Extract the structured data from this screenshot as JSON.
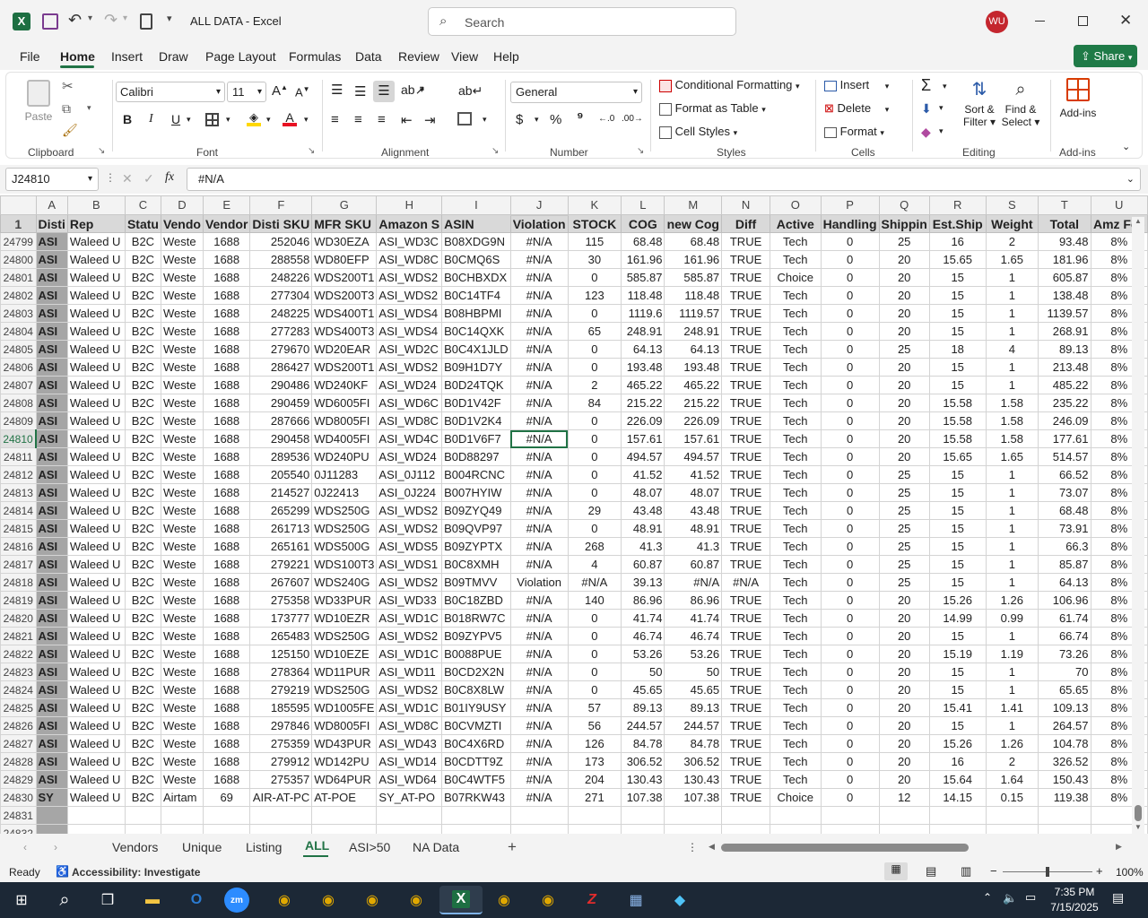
{
  "title": {
    "doc_name": "ALL DATA",
    "app_name": "Excel",
    "separator": "-",
    "search_placeholder": "Search",
    "user_initials": "WU"
  },
  "menu": {
    "tabs": [
      "File",
      "Home",
      "Insert",
      "Draw",
      "Page Layout",
      "Formulas",
      "Data",
      "Review",
      "View",
      "Help"
    ],
    "active": "Home",
    "share": "Share"
  },
  "ribbon": {
    "clipboard": {
      "label": "Clipboard",
      "paste": "Paste"
    },
    "font": {
      "label": "Font",
      "name": "Calibri",
      "size": "11"
    },
    "alignment": {
      "label": "Alignment"
    },
    "number": {
      "label": "Number",
      "format": "General"
    },
    "styles": {
      "label": "Styles",
      "conditional": "Conditional Formatting",
      "format_table": "Format as Table",
      "cell_styles": "Cell Styles"
    },
    "cells": {
      "label": "Cells",
      "insert": "Insert",
      "delete": "Delete",
      "format": "Format"
    },
    "editing": {
      "label": "Editing",
      "sort1": "Sort &",
      "sort2": "Filter",
      "find1": "Find &",
      "find2": "Select"
    },
    "addins": {
      "label": "Add-ins",
      "addins_btn": "Add-ins"
    }
  },
  "formula_bar": {
    "name_box": "J24810",
    "fx": "fx",
    "value": "#N/A"
  },
  "columns": [
    "A",
    "B",
    "C",
    "D",
    "E",
    "F",
    "G",
    "H",
    "I",
    "J",
    "K",
    "L",
    "M",
    "N",
    "O",
    "P",
    "Q",
    "R",
    "S",
    "T",
    "U"
  ],
  "header_row": {
    "num": "1",
    "cells": [
      "Disti",
      "Rep",
      "Statu",
      "Vendo",
      "Vendor",
      "Disti SKU",
      "MFR SKU",
      "Amazon S",
      "ASIN",
      "Violation",
      "STOCK",
      "COG",
      "new Cog",
      "Diff",
      "Active",
      "Handling",
      "Shippin",
      "Est.Ship",
      "Weight",
      "Total",
      "Amz Fee"
    ]
  },
  "rows": [
    {
      "num": "24799",
      "cells": [
        "ASI",
        "Waleed U",
        "B2C",
        "Weste",
        "1688",
        "252046",
        "WD30EZA",
        "ASI_WD3C",
        "B08XDG9N",
        "#N/A",
        "115",
        "68.48",
        "68.48",
        "TRUE",
        "Tech",
        "0",
        "25",
        "16",
        "2",
        "93.48",
        "8%"
      ]
    },
    {
      "num": "24800",
      "cells": [
        "ASI",
        "Waleed U",
        "B2C",
        "Weste",
        "1688",
        "288558",
        "WD80EFP",
        "ASI_WD8C",
        "B0CMQ6S",
        "#N/A",
        "30",
        "161.96",
        "161.96",
        "TRUE",
        "Tech",
        "0",
        "20",
        "15.65",
        "1.65",
        "181.96",
        "8%"
      ]
    },
    {
      "num": "24801",
      "cells": [
        "ASI",
        "Waleed U",
        "B2C",
        "Weste",
        "1688",
        "248226",
        "WDS200T1",
        "ASI_WDS2",
        "B0CHBXDX",
        "#N/A",
        "0",
        "585.87",
        "585.87",
        "TRUE",
        "Choice",
        "0",
        "20",
        "15",
        "1",
        "605.87",
        "8%"
      ]
    },
    {
      "num": "24802",
      "cells": [
        "ASI",
        "Waleed U",
        "B2C",
        "Weste",
        "1688",
        "277304",
        "WDS200T3",
        "ASI_WDS2",
        "B0C14TF4",
        "#N/A",
        "123",
        "118.48",
        "118.48",
        "TRUE",
        "Tech",
        "0",
        "20",
        "15",
        "1",
        "138.48",
        "8%"
      ]
    },
    {
      "num": "24803",
      "cells": [
        "ASI",
        "Waleed U",
        "B2C",
        "Weste",
        "1688",
        "248225",
        "WDS400T1",
        "ASI_WDS4",
        "B08HBPMI",
        "#N/A",
        "0",
        "1119.6",
        "1119.57",
        "TRUE",
        "Tech",
        "0",
        "20",
        "15",
        "1",
        "1139.57",
        "8%"
      ]
    },
    {
      "num": "24804",
      "cells": [
        "ASI",
        "Waleed U",
        "B2C",
        "Weste",
        "1688",
        "277283",
        "WDS400T3",
        "ASI_WDS4",
        "B0C14QXK",
        "#N/A",
        "65",
        "248.91",
        "248.91",
        "TRUE",
        "Tech",
        "0",
        "20",
        "15",
        "1",
        "268.91",
        "8%"
      ]
    },
    {
      "num": "24805",
      "cells": [
        "ASI",
        "Waleed U",
        "B2C",
        "Weste",
        "1688",
        "279670",
        "WD20EAR",
        "ASI_WD2C",
        "B0C4X1JLD",
        "#N/A",
        "0",
        "64.13",
        "64.13",
        "TRUE",
        "Tech",
        "0",
        "25",
        "18",
        "4",
        "89.13",
        "8%"
      ]
    },
    {
      "num": "24806",
      "cells": [
        "ASI",
        "Waleed U",
        "B2C",
        "Weste",
        "1688",
        "286427",
        "WDS200T1",
        "ASI_WDS2",
        "B09H1D7Y",
        "#N/A",
        "0",
        "193.48",
        "193.48",
        "TRUE",
        "Tech",
        "0",
        "20",
        "15",
        "1",
        "213.48",
        "8%"
      ]
    },
    {
      "num": "24807",
      "cells": [
        "ASI",
        "Waleed U",
        "B2C",
        "Weste",
        "1688",
        "290486",
        "WD240KF",
        "ASI_WD24",
        "B0D24TQK",
        "#N/A",
        "2",
        "465.22",
        "465.22",
        "TRUE",
        "Tech",
        "0",
        "20",
        "15",
        "1",
        "485.22",
        "8%"
      ]
    },
    {
      "num": "24808",
      "cells": [
        "ASI",
        "Waleed U",
        "B2C",
        "Weste",
        "1688",
        "290459",
        "WD6005FI",
        "ASI_WD6C",
        "B0D1V42F",
        "#N/A",
        "84",
        "215.22",
        "215.22",
        "TRUE",
        "Tech",
        "0",
        "20",
        "15.58",
        "1.58",
        "235.22",
        "8%"
      ]
    },
    {
      "num": "24809",
      "cells": [
        "ASI",
        "Waleed U",
        "B2C",
        "Weste",
        "1688",
        "287666",
        "WD8005FI",
        "ASI_WD8C",
        "B0D1V2K4",
        "#N/A",
        "0",
        "226.09",
        "226.09",
        "TRUE",
        "Tech",
        "0",
        "20",
        "15.58",
        "1.58",
        "246.09",
        "8%"
      ]
    },
    {
      "num": "24810",
      "cells": [
        "ASI",
        "Waleed U",
        "B2C",
        "Weste",
        "1688",
        "290458",
        "WD4005FI",
        "ASI_WD4C",
        "B0D1V6F7",
        "#N/A",
        "0",
        "157.61",
        "157.61",
        "TRUE",
        "Tech",
        "0",
        "20",
        "15.58",
        "1.58",
        "177.61",
        "8%"
      ]
    },
    {
      "num": "24811",
      "cells": [
        "ASI",
        "Waleed U",
        "B2C",
        "Weste",
        "1688",
        "289536",
        "WD240PU",
        "ASI_WD24",
        "B0D88297",
        "#N/A",
        "0",
        "494.57",
        "494.57",
        "TRUE",
        "Tech",
        "0",
        "20",
        "15.65",
        "1.65",
        "514.57",
        "8%"
      ]
    },
    {
      "num": "24812",
      "cells": [
        "ASI",
        "Waleed U",
        "B2C",
        "Weste",
        "1688",
        "205540",
        "0J11283",
        "ASI_0J112",
        "B004RCNC",
        "#N/A",
        "0",
        "41.52",
        "41.52",
        "TRUE",
        "Tech",
        "0",
        "25",
        "15",
        "1",
        "66.52",
        "8%"
      ]
    },
    {
      "num": "24813",
      "cells": [
        "ASI",
        "Waleed U",
        "B2C",
        "Weste",
        "1688",
        "214527",
        "0J22413",
        "ASI_0J224",
        "B007HYIW",
        "#N/A",
        "0",
        "48.07",
        "48.07",
        "TRUE",
        "Tech",
        "0",
        "25",
        "15",
        "1",
        "73.07",
        "8%"
      ]
    },
    {
      "num": "24814",
      "cells": [
        "ASI",
        "Waleed U",
        "B2C",
        "Weste",
        "1688",
        "265299",
        "WDS250G",
        "ASI_WDS2",
        "B09ZYQ49",
        "#N/A",
        "29",
        "43.48",
        "43.48",
        "TRUE",
        "Tech",
        "0",
        "25",
        "15",
        "1",
        "68.48",
        "8%"
      ]
    },
    {
      "num": "24815",
      "cells": [
        "ASI",
        "Waleed U",
        "B2C",
        "Weste",
        "1688",
        "261713",
        "WDS250G",
        "ASI_WDS2",
        "B09QVP97",
        "#N/A",
        "0",
        "48.91",
        "48.91",
        "TRUE",
        "Tech",
        "0",
        "25",
        "15",
        "1",
        "73.91",
        "8%"
      ]
    },
    {
      "num": "24816",
      "cells": [
        "ASI",
        "Waleed U",
        "B2C",
        "Weste",
        "1688",
        "265161",
        "WDS500G",
        "ASI_WDS5",
        "B09ZYPTX",
        "#N/A",
        "268",
        "41.3",
        "41.3",
        "TRUE",
        "Tech",
        "0",
        "25",
        "15",
        "1",
        "66.3",
        "8%"
      ]
    },
    {
      "num": "24817",
      "cells": [
        "ASI",
        "Waleed U",
        "B2C",
        "Weste",
        "1688",
        "279221",
        "WDS100T3",
        "ASI_WDS1",
        "B0C8XMH",
        "#N/A",
        "4",
        "60.87",
        "60.87",
        "TRUE",
        "Tech",
        "0",
        "25",
        "15",
        "1",
        "85.87",
        "8%"
      ]
    },
    {
      "num": "24818",
      "cells": [
        "ASI",
        "Waleed U",
        "B2C",
        "Weste",
        "1688",
        "267607",
        "WDS240G",
        "ASI_WDS2",
        "B09TMVV",
        "Violation",
        "#N/A",
        "39.13",
        "#N/A",
        "#N/A",
        "Tech",
        "0",
        "25",
        "15",
        "1",
        "64.13",
        "8%"
      ]
    },
    {
      "num": "24819",
      "cells": [
        "ASI",
        "Waleed U",
        "B2C",
        "Weste",
        "1688",
        "275358",
        "WD33PUR",
        "ASI_WD33",
        "B0C18ZBD",
        "#N/A",
        "140",
        "86.96",
        "86.96",
        "TRUE",
        "Tech",
        "0",
        "20",
        "15.26",
        "1.26",
        "106.96",
        "8%"
      ]
    },
    {
      "num": "24820",
      "cells": [
        "ASI",
        "Waleed U",
        "B2C",
        "Weste",
        "1688",
        "173777",
        "WD10EZR",
        "ASI_WD1C",
        "B018RW7C",
        "#N/A",
        "0",
        "41.74",
        "41.74",
        "TRUE",
        "Tech",
        "0",
        "20",
        "14.99",
        "0.99",
        "61.74",
        "8%"
      ]
    },
    {
      "num": "24821",
      "cells": [
        "ASI",
        "Waleed U",
        "B2C",
        "Weste",
        "1688",
        "265483",
        "WDS250G",
        "ASI_WDS2",
        "B09ZYPV5",
        "#N/A",
        "0",
        "46.74",
        "46.74",
        "TRUE",
        "Tech",
        "0",
        "20",
        "15",
        "1",
        "66.74",
        "8%"
      ]
    },
    {
      "num": "24822",
      "cells": [
        "ASI",
        "Waleed U",
        "B2C",
        "Weste",
        "1688",
        "125150",
        "WD10EZE",
        "ASI_WD1C",
        "B0088PUE",
        "#N/A",
        "0",
        "53.26",
        "53.26",
        "TRUE",
        "Tech",
        "0",
        "20",
        "15.19",
        "1.19",
        "73.26",
        "8%"
      ]
    },
    {
      "num": "24823",
      "cells": [
        "ASI",
        "Waleed U",
        "B2C",
        "Weste",
        "1688",
        "278364",
        "WD11PUR",
        "ASI_WD11",
        "B0CD2X2N",
        "#N/A",
        "0",
        "50",
        "50",
        "TRUE",
        "Tech",
        "0",
        "20",
        "15",
        "1",
        "70",
        "8%"
      ]
    },
    {
      "num": "24824",
      "cells": [
        "ASI",
        "Waleed U",
        "B2C",
        "Weste",
        "1688",
        "279219",
        "WDS250G",
        "ASI_WDS2",
        "B0C8X8LW",
        "#N/A",
        "0",
        "45.65",
        "45.65",
        "TRUE",
        "Tech",
        "0",
        "20",
        "15",
        "1",
        "65.65",
        "8%"
      ]
    },
    {
      "num": "24825",
      "cells": [
        "ASI",
        "Waleed U",
        "B2C",
        "Weste",
        "1688",
        "185595",
        "WD1005FE",
        "ASI_WD1C",
        "B01IY9USY",
        "#N/A",
        "57",
        "89.13",
        "89.13",
        "TRUE",
        "Tech",
        "0",
        "20",
        "15.41",
        "1.41",
        "109.13",
        "8%"
      ]
    },
    {
      "num": "24826",
      "cells": [
        "ASI",
        "Waleed U",
        "B2C",
        "Weste",
        "1688",
        "297846",
        "WD8005FI",
        "ASI_WD8C",
        "B0CVMZTI",
        "#N/A",
        "56",
        "244.57",
        "244.57",
        "TRUE",
        "Tech",
        "0",
        "20",
        "15",
        "1",
        "264.57",
        "8%"
      ]
    },
    {
      "num": "24827",
      "cells": [
        "ASI",
        "Waleed U",
        "B2C",
        "Weste",
        "1688",
        "275359",
        "WD43PUR",
        "ASI_WD43",
        "B0C4X6RD",
        "#N/A",
        "126",
        "84.78",
        "84.78",
        "TRUE",
        "Tech",
        "0",
        "20",
        "15.26",
        "1.26",
        "104.78",
        "8%"
      ]
    },
    {
      "num": "24828",
      "cells": [
        "ASI",
        "Waleed U",
        "B2C",
        "Weste",
        "1688",
        "279912",
        "WD142PU",
        "ASI_WD14",
        "B0CDTT9Z",
        "#N/A",
        "173",
        "306.52",
        "306.52",
        "TRUE",
        "Tech",
        "0",
        "20",
        "16",
        "2",
        "326.52",
        "8%"
      ]
    },
    {
      "num": "24829",
      "cells": [
        "ASI",
        "Waleed U",
        "B2C",
        "Weste",
        "1688",
        "275357",
        "WD64PUR",
        "ASI_WD64",
        "B0C4WTF5",
        "#N/A",
        "204",
        "130.43",
        "130.43",
        "TRUE",
        "Tech",
        "0",
        "20",
        "15.64",
        "1.64",
        "150.43",
        "8%"
      ]
    },
    {
      "num": "24830",
      "cells": [
        "SY",
        "Waleed U",
        "B2C",
        "Airtam",
        "69",
        "AIR-AT-PC",
        "AT-POE",
        "SY_AT-PO",
        "B07RKW43",
        "#N/A",
        "271",
        "107.38",
        "107.38",
        "TRUE",
        "Choice",
        "0",
        "12",
        "14.15",
        "0.15",
        "119.38",
        "8%"
      ]
    },
    {
      "num": "24831",
      "cells": [
        "",
        "",
        "",
        "",
        "",
        "",
        "",
        "",
        "",
        "",
        "",
        "",
        "",
        "",
        "",
        "",
        "",
        "",
        "",
        "",
        ""
      ]
    },
    {
      "num": "24832",
      "cells": [
        "",
        "",
        "",
        "",
        "",
        "",
        "",
        "",
        "",
        "",
        "",
        "",
        "",
        "",
        "",
        "",
        "",
        "",
        "",
        "",
        ""
      ]
    }
  ],
  "sheets": {
    "tabs": [
      "Vendors",
      "Unique",
      "Listing",
      "ALL",
      "ASI>50",
      "NA Data"
    ],
    "active": "ALL"
  },
  "status": {
    "ready": "Ready",
    "accessibility": "Accessibility: Investigate",
    "zoom": "100%"
  },
  "clock": {
    "time": "7:35 PM",
    "date": "7/15/2025"
  }
}
